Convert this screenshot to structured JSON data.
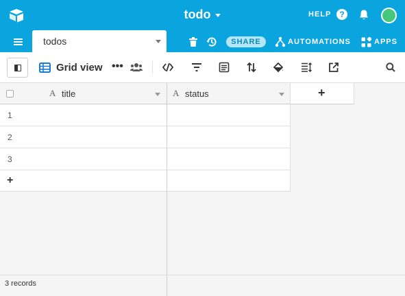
{
  "header": {
    "base_name": "todo",
    "help_label": "HELP",
    "help_icon_glyph": "?"
  },
  "tabbar": {
    "table_tab": "todos",
    "share_label": "SHARE",
    "automations_label": "AUTOMATIONS",
    "apps_label": "APPS"
  },
  "viewbar": {
    "view_name": "Grid view",
    "more_glyph": "•••"
  },
  "grid": {
    "columns": [
      {
        "name": "title",
        "type_icon": "A"
      },
      {
        "name": "status",
        "type_icon": "A"
      }
    ],
    "add_field_glyph": "+",
    "rows": [
      {
        "num": "1",
        "title": "",
        "status": ""
      },
      {
        "num": "2",
        "title": "",
        "status": ""
      },
      {
        "num": "3",
        "title": "",
        "status": ""
      }
    ],
    "add_row_glyph": "+"
  },
  "footer": {
    "record_count": "3 records"
  },
  "colors": {
    "accent": "#0aa5df",
    "share_bg": "#b5e6f6",
    "avatar": "#46c77e",
    "grid_icon": "#1a7ad8"
  },
  "icons": [
    "airtable-logo-icon",
    "caret-down-icon",
    "help-icon",
    "bell-icon",
    "avatar",
    "hamburger-icon",
    "trash-icon",
    "history-icon",
    "automations-icon",
    "apps-icon",
    "sidebar-toggle-icon",
    "grid-view-icon",
    "more-icon",
    "people-icon",
    "hide-fields-icon",
    "filter-icon",
    "group-icon",
    "sort-icon",
    "color-icon",
    "row-height-icon",
    "share-view-icon",
    "search-icon",
    "checkbox-icon",
    "text-field-icon",
    "plus-icon"
  ]
}
